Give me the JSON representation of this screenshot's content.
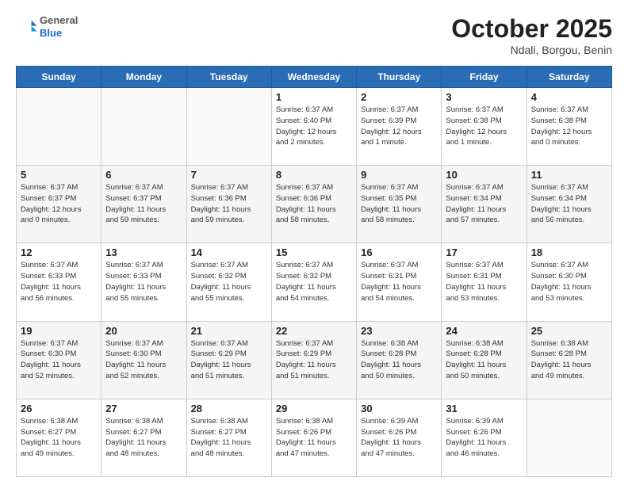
{
  "logo": {
    "general": "General",
    "blue": "Blue"
  },
  "header": {
    "title": "October 2025",
    "subtitle": "Ndali, Borgou, Benin"
  },
  "weekdays": [
    "Sunday",
    "Monday",
    "Tuesday",
    "Wednesday",
    "Thursday",
    "Friday",
    "Saturday"
  ],
  "weeks": [
    [
      {
        "day": "",
        "info": ""
      },
      {
        "day": "",
        "info": ""
      },
      {
        "day": "",
        "info": ""
      },
      {
        "day": "1",
        "info": "Sunrise: 6:37 AM\nSunset: 6:40 PM\nDaylight: 12 hours\nand 2 minutes."
      },
      {
        "day": "2",
        "info": "Sunrise: 6:37 AM\nSunset: 6:39 PM\nDaylight: 12 hours\nand 1 minute."
      },
      {
        "day": "3",
        "info": "Sunrise: 6:37 AM\nSunset: 6:38 PM\nDaylight: 12 hours\nand 1 minute."
      },
      {
        "day": "4",
        "info": "Sunrise: 6:37 AM\nSunset: 6:38 PM\nDaylight: 12 hours\nand 0 minutes."
      }
    ],
    [
      {
        "day": "5",
        "info": "Sunrise: 6:37 AM\nSunset: 6:37 PM\nDaylight: 12 hours\nand 0 minutes."
      },
      {
        "day": "6",
        "info": "Sunrise: 6:37 AM\nSunset: 6:37 PM\nDaylight: 11 hours\nand 59 minutes."
      },
      {
        "day": "7",
        "info": "Sunrise: 6:37 AM\nSunset: 6:36 PM\nDaylight: 11 hours\nand 59 minutes."
      },
      {
        "day": "8",
        "info": "Sunrise: 6:37 AM\nSunset: 6:36 PM\nDaylight: 11 hours\nand 58 minutes."
      },
      {
        "day": "9",
        "info": "Sunrise: 6:37 AM\nSunset: 6:35 PM\nDaylight: 11 hours\nand 58 minutes."
      },
      {
        "day": "10",
        "info": "Sunrise: 6:37 AM\nSunset: 6:34 PM\nDaylight: 11 hours\nand 57 minutes."
      },
      {
        "day": "11",
        "info": "Sunrise: 6:37 AM\nSunset: 6:34 PM\nDaylight: 11 hours\nand 56 minutes."
      }
    ],
    [
      {
        "day": "12",
        "info": "Sunrise: 6:37 AM\nSunset: 6:33 PM\nDaylight: 11 hours\nand 56 minutes."
      },
      {
        "day": "13",
        "info": "Sunrise: 6:37 AM\nSunset: 6:33 PM\nDaylight: 11 hours\nand 55 minutes."
      },
      {
        "day": "14",
        "info": "Sunrise: 6:37 AM\nSunset: 6:32 PM\nDaylight: 11 hours\nand 55 minutes."
      },
      {
        "day": "15",
        "info": "Sunrise: 6:37 AM\nSunset: 6:32 PM\nDaylight: 11 hours\nand 54 minutes."
      },
      {
        "day": "16",
        "info": "Sunrise: 6:37 AM\nSunset: 6:31 PM\nDaylight: 11 hours\nand 54 minutes."
      },
      {
        "day": "17",
        "info": "Sunrise: 6:37 AM\nSunset: 6:31 PM\nDaylight: 11 hours\nand 53 minutes."
      },
      {
        "day": "18",
        "info": "Sunrise: 6:37 AM\nSunset: 6:30 PM\nDaylight: 11 hours\nand 53 minutes."
      }
    ],
    [
      {
        "day": "19",
        "info": "Sunrise: 6:37 AM\nSunset: 6:30 PM\nDaylight: 11 hours\nand 52 minutes."
      },
      {
        "day": "20",
        "info": "Sunrise: 6:37 AM\nSunset: 6:30 PM\nDaylight: 11 hours\nand 52 minutes."
      },
      {
        "day": "21",
        "info": "Sunrise: 6:37 AM\nSunset: 6:29 PM\nDaylight: 11 hours\nand 51 minutes."
      },
      {
        "day": "22",
        "info": "Sunrise: 6:37 AM\nSunset: 6:29 PM\nDaylight: 11 hours\nand 51 minutes."
      },
      {
        "day": "23",
        "info": "Sunrise: 6:38 AM\nSunset: 6:28 PM\nDaylight: 11 hours\nand 50 minutes."
      },
      {
        "day": "24",
        "info": "Sunrise: 6:38 AM\nSunset: 6:28 PM\nDaylight: 11 hours\nand 50 minutes."
      },
      {
        "day": "25",
        "info": "Sunrise: 6:38 AM\nSunset: 6:28 PM\nDaylight: 11 hours\nand 49 minutes."
      }
    ],
    [
      {
        "day": "26",
        "info": "Sunrise: 6:38 AM\nSunset: 6:27 PM\nDaylight: 11 hours\nand 49 minutes."
      },
      {
        "day": "27",
        "info": "Sunrise: 6:38 AM\nSunset: 6:27 PM\nDaylight: 11 hours\nand 48 minutes."
      },
      {
        "day": "28",
        "info": "Sunrise: 6:38 AM\nSunset: 6:27 PM\nDaylight: 11 hours\nand 48 minutes."
      },
      {
        "day": "29",
        "info": "Sunrise: 6:38 AM\nSunset: 6:26 PM\nDaylight: 11 hours\nand 47 minutes."
      },
      {
        "day": "30",
        "info": "Sunrise: 6:39 AM\nSunset: 6:26 PM\nDaylight: 11 hours\nand 47 minutes."
      },
      {
        "day": "31",
        "info": "Sunrise: 6:39 AM\nSunset: 6:26 PM\nDaylight: 11 hours\nand 46 minutes."
      },
      {
        "day": "",
        "info": ""
      }
    ]
  ]
}
